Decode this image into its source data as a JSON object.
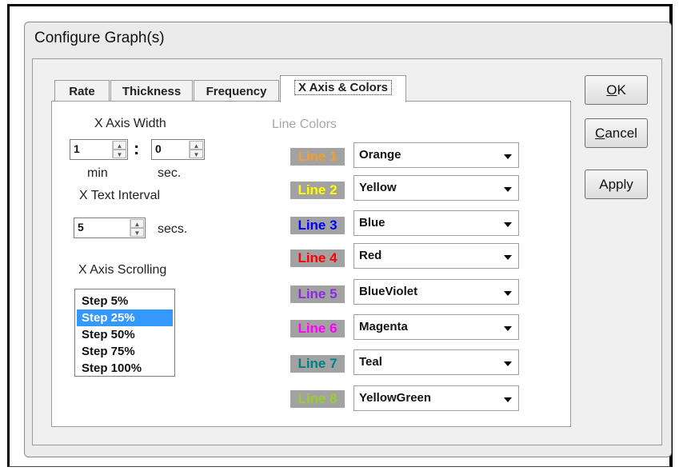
{
  "dialog": {
    "title": "Configure Graph(s)"
  },
  "tabs": [
    {
      "label": "Rate"
    },
    {
      "label": "Thickness"
    },
    {
      "label": "Frequency"
    },
    {
      "label": "X Axis & Colors",
      "active": true
    }
  ],
  "xaxis": {
    "width_label": "X Axis Width",
    "min_value": "1",
    "sec_value": "0",
    "colon": ":",
    "min_label": "min",
    "sec_label": "sec.",
    "text_interval_label": "X Text Interval",
    "interval_value": "5",
    "interval_unit": "secs.",
    "scrolling_label": "X Axis Scrolling",
    "scroll_options": [
      "Step 5%",
      "Step 25%",
      "Step 50%",
      "Step 75%",
      "Step 100%"
    ],
    "scroll_selected": "Step 25%"
  },
  "line_colors": {
    "title": "Line Colors",
    "lines": [
      {
        "label": "Line 1",
        "value": "Orange",
        "color": "#f0a030"
      },
      {
        "label": "Line 2",
        "value": "Yellow",
        "color": "#ffff00"
      },
      {
        "label": "Line 3",
        "value": "Blue",
        "color": "#0000ff"
      },
      {
        "label": "Line 4",
        "value": "Red",
        "color": "#ff0000"
      },
      {
        "label": "Line 5",
        "value": "BlueViolet",
        "color": "#8a2be2"
      },
      {
        "label": "Line 6",
        "value": "Magenta",
        "color": "#ff00ff"
      },
      {
        "label": "Line 7",
        "value": "Teal",
        "color": "#008080"
      },
      {
        "label": "Line 8",
        "value": "YellowGreen",
        "color": "#9acd32"
      }
    ]
  },
  "buttons": {
    "ok_label": "OK",
    "ok_accel": "O",
    "ok_rest": "K",
    "cancel_label": "Cancel",
    "cancel_accel": "C",
    "cancel_rest": "ancel",
    "apply_label": "Apply"
  },
  "icons": {
    "spin_up": "spin-up-arrow-icon",
    "spin_down": "spin-down-arrow-icon",
    "dropdown": "chevron-down-icon"
  }
}
